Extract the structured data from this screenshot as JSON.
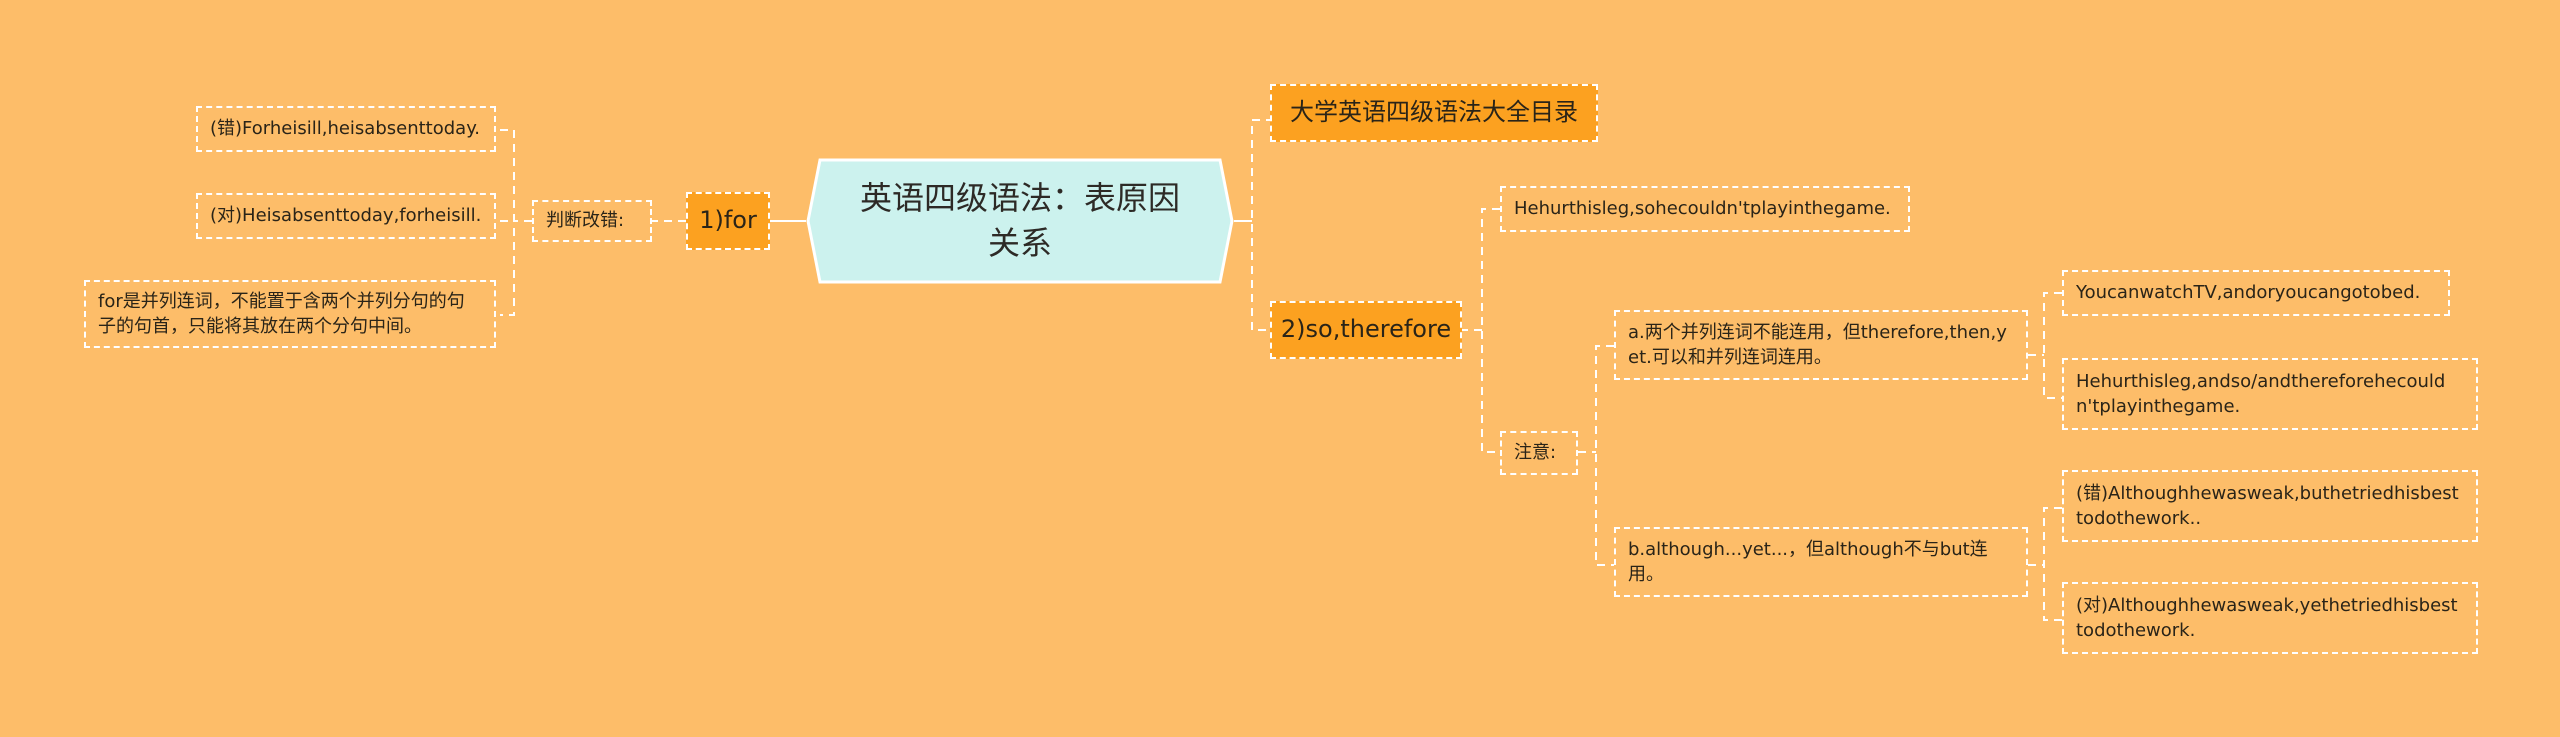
{
  "colors": {
    "background": "#fdbd69",
    "root_fill": "#ccf2ee",
    "branch_fill": "#fca120",
    "connector": "#ffffff"
  },
  "root": {
    "label": "英语四级语法：表原因关系"
  },
  "left": {
    "branch": {
      "label": "1)for"
    },
    "sub": {
      "label": "判断改错:"
    },
    "leaves": [
      {
        "label": "(错)Forheisill,heisabsenttoday."
      },
      {
        "label": "(对)Heisabsenttoday,forheisill."
      },
      {
        "label": "for是并列连词，不能置于含两个并列分句的句子的句首，只能将其放在两个分句中间。"
      }
    ]
  },
  "right": {
    "top_branch": {
      "label": "大学英语四级语法大全目录"
    },
    "branch": {
      "label": "2)so,therefore"
    },
    "example": {
      "label": "Hehurthisleg,sohecouldn'tplayinthegame."
    },
    "note": {
      "label": "注意:"
    },
    "points": [
      {
        "label": "a.两个并列连词不能连用，但therefore,then,yet.可以和并列连词连用。",
        "examples": [
          {
            "label": "YoucanwatchTV,andoryoucangotobed."
          },
          {
            "label": "Hehurthisleg,andso/andtherefore​hecouldn'tplayinthegame."
          }
        ]
      },
      {
        "label": "b.although...yet...，但although不与but连用。",
        "examples": [
          {
            "label": "(错)Althoughhewasweak,buthetriedhisbesttodothework.."
          },
          {
            "label": "(对)Althoughhewasweak,yethetriedhisbesttodothework."
          }
        ]
      }
    ]
  }
}
